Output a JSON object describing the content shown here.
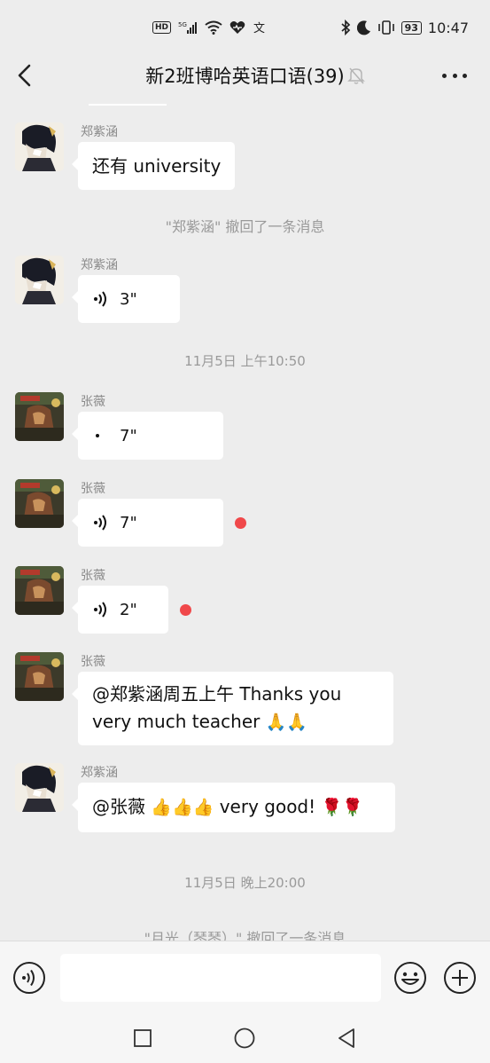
{
  "status_bar": {
    "left_glyphs": [
      "HD",
      "5G",
      "wifi",
      "heart",
      "文"
    ],
    "time": "10:47",
    "battery": "93"
  },
  "header": {
    "title": "新2班博哈英语口语(39)"
  },
  "messages": [
    {
      "sender": "郑紫涵",
      "type": "text",
      "text": "还有 university"
    },
    {
      "type": "system",
      "text": "\"郑紫涵\" 撤回了一条消息"
    },
    {
      "sender": "郑紫涵",
      "type": "voice",
      "duration": "3\""
    },
    {
      "type": "time",
      "text": "11月5日 上午10:50"
    },
    {
      "sender": "张薇",
      "type": "voice",
      "duration": "7\"",
      "playing": true
    },
    {
      "sender": "张薇",
      "type": "voice",
      "duration": "7\"",
      "unread": true
    },
    {
      "sender": "张薇",
      "type": "voice",
      "duration": "2\"",
      "unread": true
    },
    {
      "sender": "张薇",
      "type": "text",
      "line1": "@郑紫涵周五上午  Thanks you",
      "line2": "very much teacher",
      "emoji": "🙏🙏"
    },
    {
      "sender": "郑紫涵",
      "type": "text",
      "text": "@张薇 ",
      "emoji1": "👍👍👍",
      "text2": "very good!",
      "emoji2": "🌹🌹"
    },
    {
      "type": "time",
      "text": "11月5日 晚上20:00"
    },
    {
      "type": "system",
      "text": "\"月光（琴琴）\" 撤回了一条消息"
    }
  ],
  "input": {
    "placeholder": ""
  },
  "colors": {
    "background": "#ededed",
    "bubble": "#ffffff",
    "unread_dot": "#f0484a",
    "meta_text": "#9a9a9a"
  },
  "icons": [
    "back-icon",
    "mute-bell-icon",
    "more-icon",
    "voice-toggle-icon",
    "emoji-icon",
    "plus-icon",
    "square-nav-icon",
    "circle-nav-icon",
    "triangle-nav-icon"
  ]
}
